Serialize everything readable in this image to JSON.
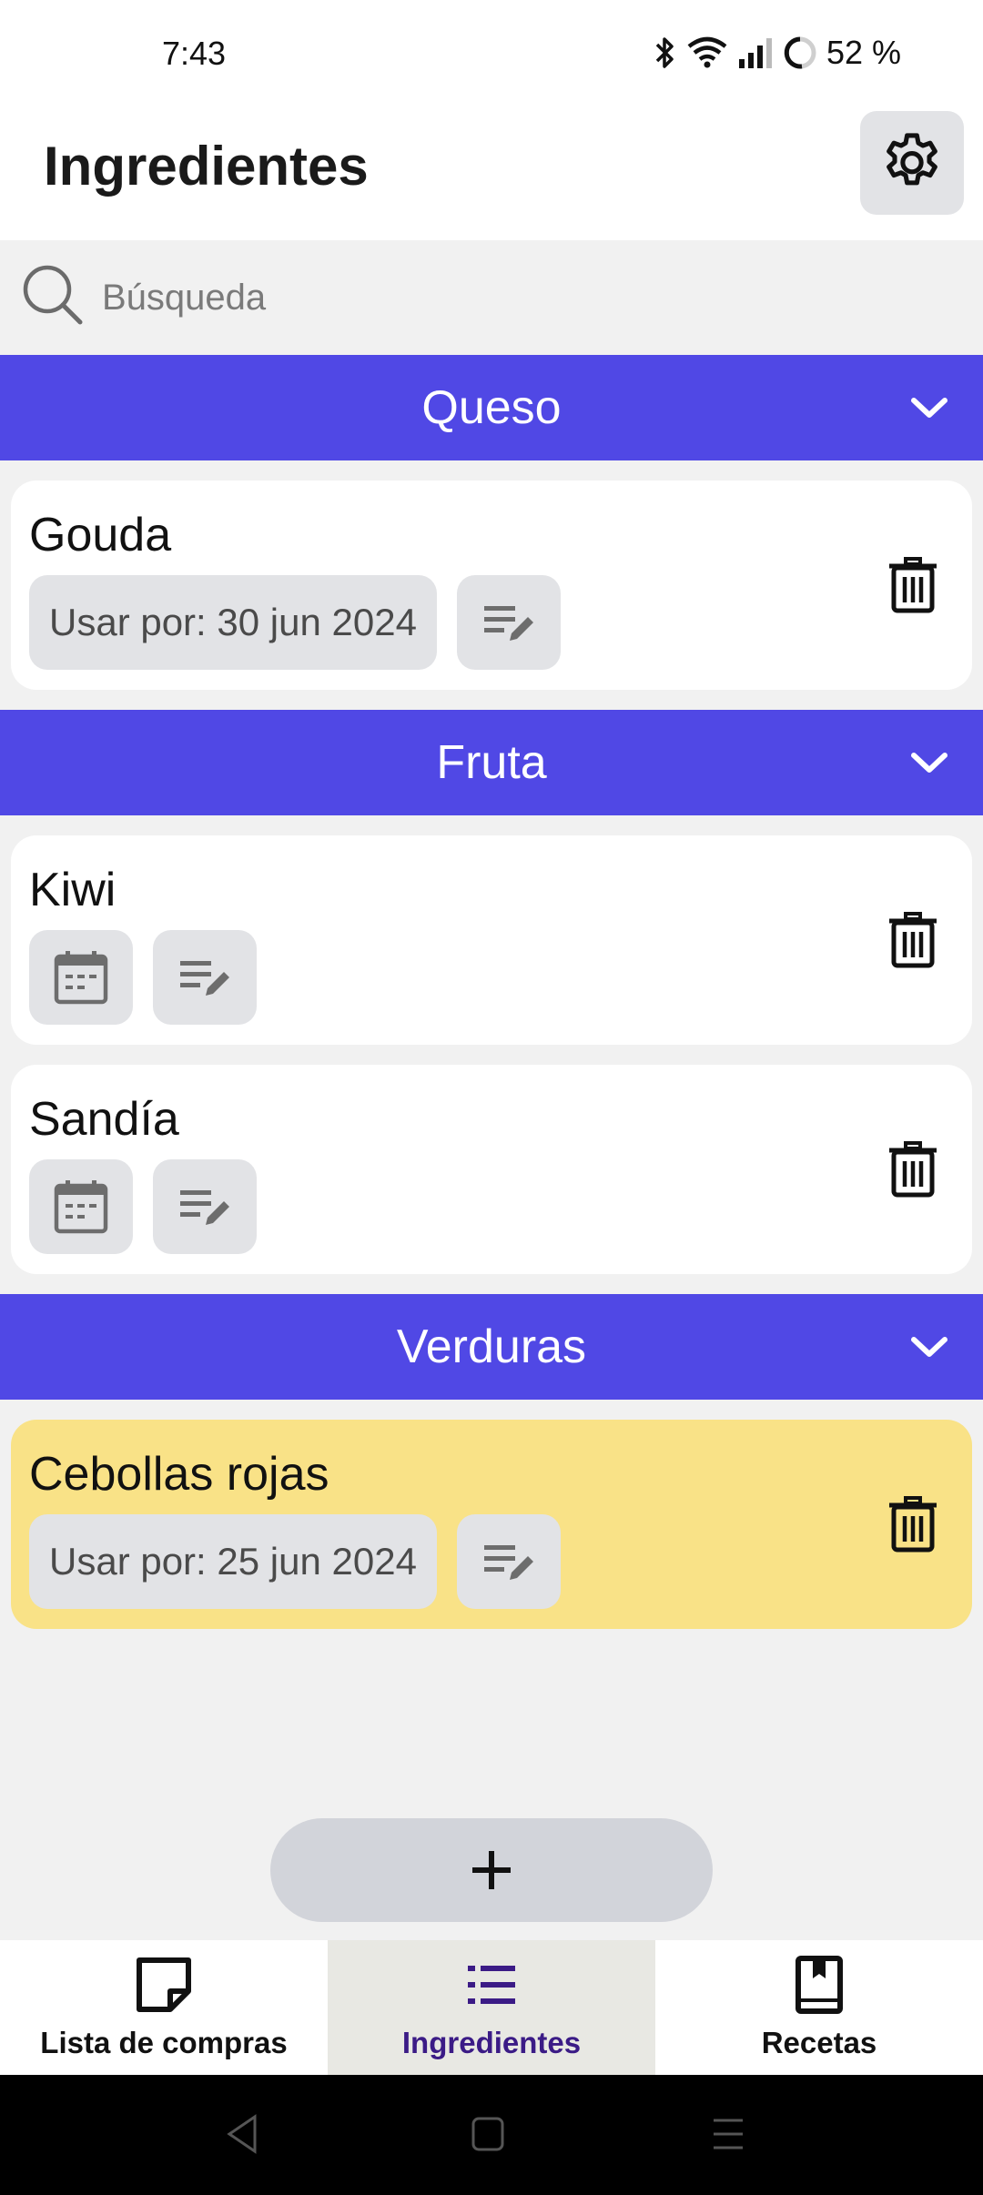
{
  "status": {
    "time": "7:43",
    "battery": "52 %"
  },
  "header": {
    "title": "Ingredientes",
    "settings_icon": "gear-icon"
  },
  "search": {
    "placeholder": "Búsqueda",
    "value": ""
  },
  "colors": {
    "category": "#5048e5",
    "expiring_card": "#f9e287",
    "chip": "#e2e3e6",
    "active_nav_text": "#3b1b86"
  },
  "categories": [
    {
      "name": "Queso",
      "items": [
        {
          "name": "Gouda",
          "date": "Usar por: 30 jun 2024",
          "highlight": false
        }
      ]
    },
    {
      "name": "Fruta",
      "items": [
        {
          "name": "Kiwi",
          "date": "",
          "highlight": false
        },
        {
          "name": "Sandía",
          "date": "",
          "highlight": false
        }
      ]
    },
    {
      "name": "Verduras",
      "items": [
        {
          "name": "Cebollas rojas",
          "date": "Usar por: 25 jun 2024",
          "highlight": true
        }
      ]
    }
  ],
  "fab": {
    "icon": "plus-icon"
  },
  "nav": {
    "items": [
      {
        "label": "Lista de compras",
        "icon": "note-icon",
        "active": false
      },
      {
        "label": "Ingredientes",
        "icon": "list-icon",
        "active": true
      },
      {
        "label": "Recetas",
        "icon": "book-icon",
        "active": false
      }
    ]
  }
}
